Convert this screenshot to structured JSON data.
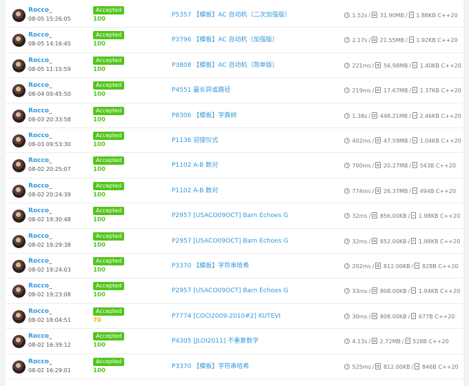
{
  "colors": {
    "accepted_badge": "#52c41a",
    "score_full": "#52c41a",
    "score_partial": "#f0b500",
    "link": "#3498db"
  },
  "records": [
    {
      "user": "Rocco_",
      "time": "08-05 15:26:05",
      "status": "Accepted",
      "score": "100",
      "problem": "P5357 【模板】AC 自动机（二次加强版）",
      "runtime": "1.52s",
      "memory": "31.90MB",
      "code_size": "1.88KB",
      "language": "C++20"
    },
    {
      "user": "Rocco_",
      "time": "08-05 14:16:45",
      "status": "Accepted",
      "score": "100",
      "problem": "P3796 【模板】AC 自动机（加强版）",
      "runtime": "2.17s",
      "memory": "21.55MB",
      "code_size": "1.92KB",
      "language": "C++20"
    },
    {
      "user": "Rocco_",
      "time": "08-05 11:15:59",
      "status": "Accepted",
      "score": "100",
      "problem": "P3808 【模板】AC 自动机（简单版）",
      "runtime": "221ms",
      "memory": "56.98MB",
      "code_size": "1.40KB",
      "language": "C++20"
    },
    {
      "user": "Rocco_",
      "time": "08-04 09:45:50",
      "status": "Accepted",
      "score": "100",
      "problem": "P4551 最长异或路径",
      "runtime": "219ms",
      "memory": "17.67MB",
      "code_size": "1.37KB",
      "language": "C++20"
    },
    {
      "user": "Rocco_",
      "time": "08-03 20:33:58",
      "status": "Accepted",
      "score": "100",
      "problem": "P8306 【模板】字典树",
      "runtime": "1.38s",
      "memory": "448.21MB",
      "code_size": "2.46KB",
      "language": "C++20"
    },
    {
      "user": "Rocco_",
      "time": "08-03 09:53:30",
      "status": "Accepted",
      "score": "100",
      "problem": "P1136 迎接仪式",
      "runtime": "402ms",
      "memory": "47.59MB",
      "code_size": "1.04KB",
      "language": "C++20"
    },
    {
      "user": "Rocco_",
      "time": "08-02 20:25:07",
      "status": "Accepted",
      "score": "100",
      "problem": "P1102 A-B 数对",
      "runtime": "700ms",
      "memory": "20.27MB",
      "code_size": "543B",
      "language": "C++20"
    },
    {
      "user": "Rocco_",
      "time": "08-02 20:24:39",
      "status": "Accepted",
      "score": "100",
      "problem": "P1102 A-B 数对",
      "runtime": "774ms",
      "memory": "26.37MB",
      "code_size": "494B",
      "language": "C++20"
    },
    {
      "user": "Rocco_",
      "time": "08-02 19:30:48",
      "status": "Accepted",
      "score": "100",
      "problem": "P2957 [USACO09OCT] Barn Echoes G",
      "runtime": "32ms",
      "memory": "856.00KB",
      "code_size": "1.98KB",
      "language": "C++20"
    },
    {
      "user": "Rocco_",
      "time": "08-02 19:29:38",
      "status": "Accepted",
      "score": "100",
      "problem": "P2957 [USACO09OCT] Barn Echoes G",
      "runtime": "32ms",
      "memory": "852.00KB",
      "code_size": "1.98KB",
      "language": "C++20"
    },
    {
      "user": "Rocco_",
      "time": "08-02 19:24:03",
      "status": "Accepted",
      "score": "100",
      "problem": "P3370 【模板】字符串哈希",
      "runtime": "202ms",
      "memory": "812.00KB",
      "code_size": "828B",
      "language": "C++20"
    },
    {
      "user": "Rocco_",
      "time": "08-02 19:23:08",
      "status": "Accepted",
      "score": "100",
      "problem": "P2957 [USACO09OCT] Barn Echoes G",
      "runtime": "33ms",
      "memory": "808.00KB",
      "code_size": "1.94KB",
      "language": "C++20"
    },
    {
      "user": "Rocco_",
      "time": "08-02 18:04:51",
      "status": "Accepted",
      "score": "70",
      "problem": "P7774 [COCI2009-2010#2] KUTEVI",
      "runtime": "30ms",
      "memory": "808.00KB",
      "code_size": "677B",
      "language": "C++20"
    },
    {
      "user": "Rocco_",
      "time": "08-02 16:39:12",
      "status": "Accepted",
      "score": "100",
      "problem": "P4305 [JLOI2011] 不重复数字",
      "runtime": "4.13s",
      "memory": "2.72MB",
      "code_size": "528B",
      "language": "C++20"
    },
    {
      "user": "Rocco_",
      "time": "08-02 16:29:01",
      "status": "Accepted",
      "score": "100",
      "problem": "P3370 【模板】字符串哈希",
      "runtime": "525ms",
      "memory": "812.00KB",
      "code_size": "846B",
      "language": "C++20"
    }
  ]
}
